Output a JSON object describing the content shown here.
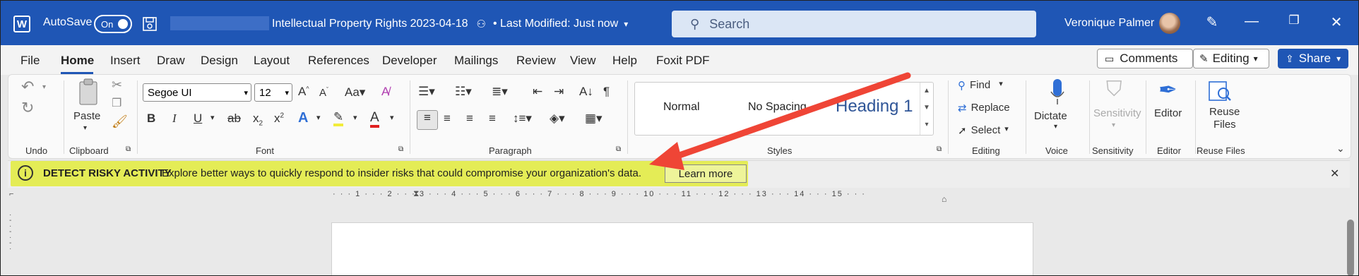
{
  "titlebar": {
    "autosave_label": "AutoSave",
    "toggle_state": "On",
    "document_title": "Intellectual Property Rights 2023-04-18",
    "last_modified": "• Last Modified: Just now",
    "search_placeholder": "Search",
    "user_name": "Veronique Palmer"
  },
  "menu": {
    "tabs": [
      "File",
      "Home",
      "Insert",
      "Draw",
      "Design",
      "Layout",
      "References",
      "Developer",
      "Mailings",
      "Review",
      "View",
      "Help",
      "Foxit PDF"
    ],
    "active": "Home",
    "comments_label": "Comments",
    "editing_label": "Editing",
    "share_label": "Share"
  },
  "ribbon": {
    "undo_label": "Undo",
    "clipboard": {
      "paste_label": "Paste",
      "group_label": "Clipboard"
    },
    "font": {
      "name": "Segoe UI",
      "size": "12",
      "group_label": "Font"
    },
    "paragraph": {
      "group_label": "Paragraph"
    },
    "styles": {
      "items": [
        "Normal",
        "No Spacing",
        "Heading 1"
      ],
      "group_label": "Styles"
    },
    "editing": {
      "find": "Find",
      "replace": "Replace",
      "select": "Select",
      "group_label": "Editing"
    },
    "voice": {
      "dictate": "Dictate",
      "group_label": "Voice"
    },
    "sensitivity": {
      "label": "Sensitivity",
      "group_label": "Sensitivity"
    },
    "editor": {
      "label": "Editor",
      "group_label": "Editor"
    },
    "reuse": {
      "label_line1": "Reuse",
      "label_line2": "Files",
      "group_label": "Reuse Files"
    }
  },
  "infobar": {
    "title": "DETECT RISKY ACTIVITY",
    "message": "Explore better ways to quickly respond to insider risks that could compromise your organization's data.",
    "button": "Learn more"
  },
  "ruler": {
    "text": "· · · 1 · · · 2 · · · 3 · · · 4 · · · 5 · · · 6 · · · 7 · · · 8 · · · 9 · · · 10 · · · 11 · · · 12 · · · 13 · · · 14 · · · 15 · · ·"
  },
  "colors": {
    "titlebar": "#1f56b5",
    "highlight": "#e4ec56",
    "arrow": "#ef4536"
  }
}
